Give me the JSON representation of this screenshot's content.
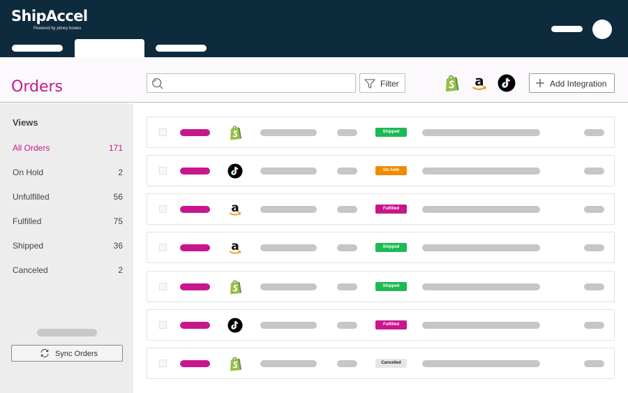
{
  "app": {
    "logo_title": "ShipAccel",
    "logo_subtitle": "Powered by pitney bowes"
  },
  "header": {
    "title": "Orders",
    "search_placeholder": "",
    "filter_label": "Filter",
    "integrations": [
      "shopify-icon",
      "amazon-icon",
      "tiktok-icon"
    ],
    "add_integration_label": "Add Integration"
  },
  "sidebar": {
    "views_title": "Views",
    "items": [
      {
        "label": "All Orders",
        "count": "171",
        "active": true
      },
      {
        "label": "On Hold",
        "count": "2",
        "active": false
      },
      {
        "label": "Unfulfilled",
        "count": "56",
        "active": false
      },
      {
        "label": "Fulfilled",
        "count": "75",
        "active": false
      },
      {
        "label": "Shipped",
        "count": "36",
        "active": false
      },
      {
        "label": "Canceled",
        "count": "2",
        "active": false
      }
    ],
    "sync_label": "Sync Orders"
  },
  "colors": {
    "accent": "#c8168d",
    "topbar": "#0e2a3d",
    "shipped": "#1db954",
    "on_hold": "#f08a00",
    "fulfilled": "#c8168d",
    "cancelled": "#e6e6e6"
  },
  "orders": [
    {
      "channel": "shopify",
      "status": "Shipped"
    },
    {
      "channel": "tiktok",
      "status": "On hold"
    },
    {
      "channel": "amazon",
      "status": "Fulfilled"
    },
    {
      "channel": "amazon",
      "status": "Shipped"
    },
    {
      "channel": "shopify",
      "status": "Shipped"
    },
    {
      "channel": "tiktok",
      "status": "Fulfilled"
    },
    {
      "channel": "shopify",
      "status": "Cancelled"
    }
  ]
}
